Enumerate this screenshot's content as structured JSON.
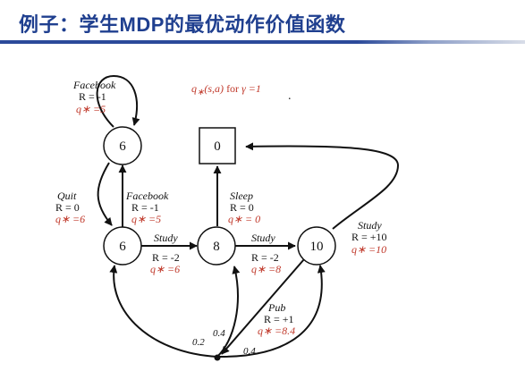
{
  "slide": {
    "title": "例子：学生MDP的最优动作价值函数"
  },
  "header_note": {
    "q": "q",
    "star": "∗",
    "args": "(s,a)",
    "for_text": " for ",
    "gamma": "γ =1",
    "dot": "."
  },
  "nodes": {
    "facebook_state": "6",
    "class1": "6",
    "class2": "8",
    "class3": "10",
    "sleep": "0"
  },
  "edges": {
    "facebook_loop": {
      "action": "Facebook",
      "reward": "R = -1",
      "q": "q∗ =5"
    },
    "quit": {
      "action": "Quit",
      "reward": "R = 0",
      "q": "q∗ =6"
    },
    "facebook": {
      "action": "Facebook",
      "reward": "R = -1",
      "q": "q∗ =5"
    },
    "study1": {
      "action": "Study",
      "reward": "R = -2",
      "q": "q∗ =6"
    },
    "study2": {
      "action": "Study",
      "reward": "R = -2",
      "q": "q∗ =8"
    },
    "sleep": {
      "action": "Sleep",
      "reward": "R = 0",
      "q": "q∗ = 0"
    },
    "study3": {
      "action": "Study",
      "reward": "R = +10",
      "q": "q∗ =10"
    },
    "pub": {
      "action": "Pub",
      "reward": "R = +1",
      "q": "q∗ =8.4"
    }
  },
  "probabilities": {
    "p_class1": "0.2",
    "p_class2": "0.4",
    "p_class3": "0.4"
  }
}
